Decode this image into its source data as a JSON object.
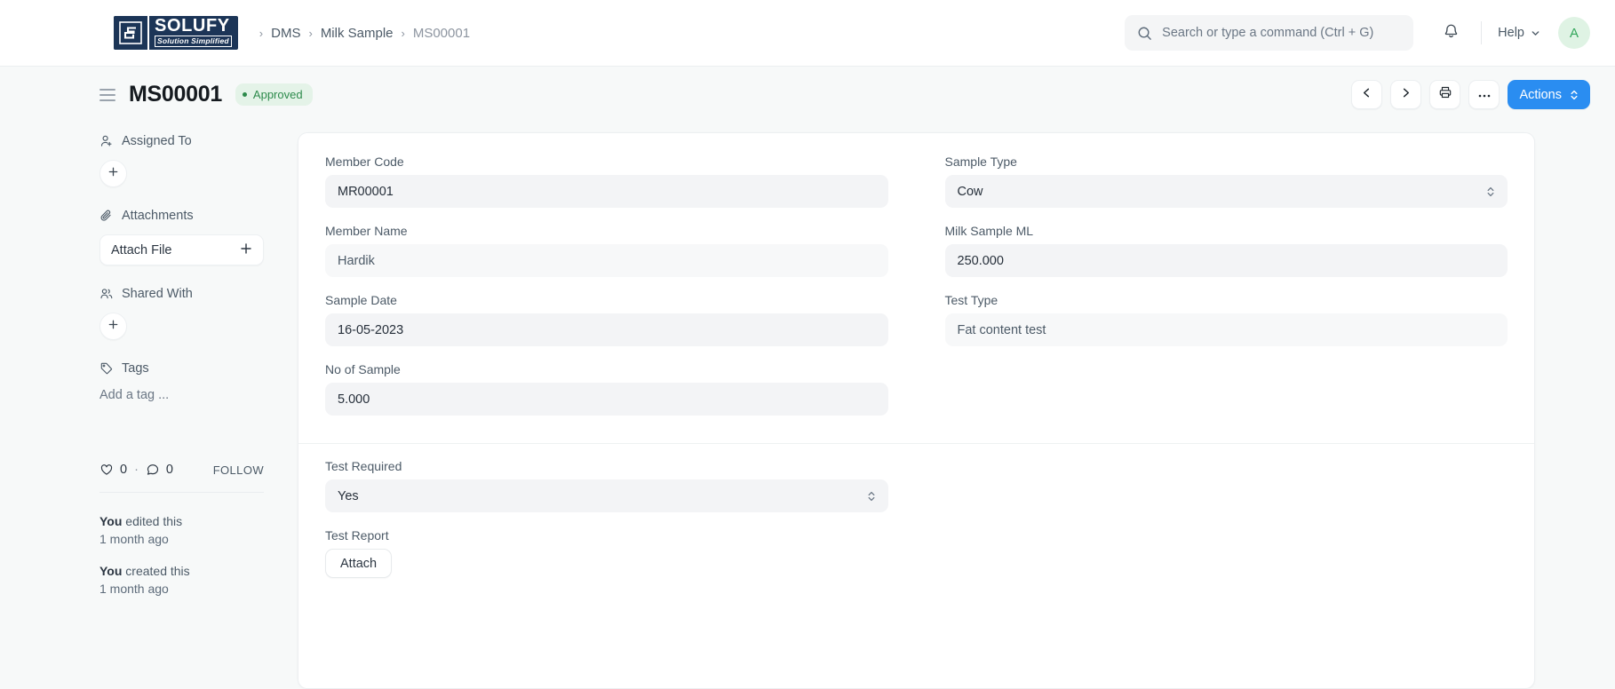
{
  "navbar": {
    "logo": {
      "name": "solufy-logo",
      "mark": "S",
      "word": "SOLUFY",
      "tagline": "Solution Simplified"
    },
    "breadcrumb": [
      {
        "label": "DMS",
        "current": false
      },
      {
        "label": "Milk Sample",
        "current": false
      },
      {
        "label": "MS00001",
        "current": true
      }
    ],
    "separator": "›",
    "search": {
      "placeholder": "Search or type a command (Ctrl + G)",
      "value": "",
      "icon": "search-icon"
    },
    "notifications_icon": "bell-icon",
    "help_label": "Help",
    "avatar_initial": "A"
  },
  "page_head": {
    "menu_icon": "hamburger-icon",
    "title": "MS00001",
    "status": "Approved",
    "status_color": "#2c8a4b",
    "prev_icon": "chevron-left-icon",
    "next_icon": "chevron-right-icon",
    "print_icon": "printer-icon",
    "more_icon": "ellipsis-icon",
    "actions_label": "Actions",
    "actions_color": "#2a8df1"
  },
  "sidebar": {
    "assigned_to": {
      "label": "Assigned To",
      "icon": "user-plus-icon",
      "add": "+"
    },
    "attachments": {
      "label": "Attachments",
      "icon": "paperclip-icon",
      "button_label": "Attach File",
      "add": "+"
    },
    "shared_with": {
      "label": "Shared With",
      "icon": "users-icon",
      "add": "+"
    },
    "tags": {
      "label": "Tags",
      "icon": "tag-icon",
      "placeholder": "Add a tag ..."
    },
    "meta": {
      "like_icon": "heart-icon",
      "like_count": "0",
      "separator": "·",
      "comment_icon": "comment-icon",
      "comment_count": "0",
      "follow_label": "FOLLOW"
    },
    "activity": [
      {
        "actor": "You",
        "action": "edited this",
        "time": "1 month ago"
      },
      {
        "actor": "You",
        "action": "created this",
        "time": "1 month ago"
      }
    ]
  },
  "form": {
    "sections": [
      {
        "left": [
          {
            "label": "Member Code",
            "value": "MR00001",
            "type": "text",
            "style": "filled"
          },
          {
            "label": "Member Name",
            "value": "Hardik",
            "type": "text",
            "style": "soft"
          },
          {
            "label": "Sample Date",
            "value": "16-05-2023",
            "type": "text",
            "style": "filled"
          },
          {
            "label": "No of Sample",
            "value": "5.000",
            "type": "text",
            "style": "filled"
          }
        ],
        "right": [
          {
            "label": "Sample Type",
            "value": "Cow",
            "type": "select",
            "style": "filled"
          },
          {
            "label": "Milk Sample ML",
            "value": "250.000",
            "type": "text",
            "style": "filled"
          },
          {
            "label": "Test Type",
            "value": "Fat content test",
            "type": "text",
            "style": "soft"
          }
        ]
      },
      {
        "left": [
          {
            "label": "Test Required",
            "value": "Yes",
            "type": "select",
            "style": "filled"
          },
          {
            "label": "Test Report",
            "value": "Attach",
            "type": "attach",
            "style": "button"
          }
        ],
        "right": []
      }
    ]
  }
}
